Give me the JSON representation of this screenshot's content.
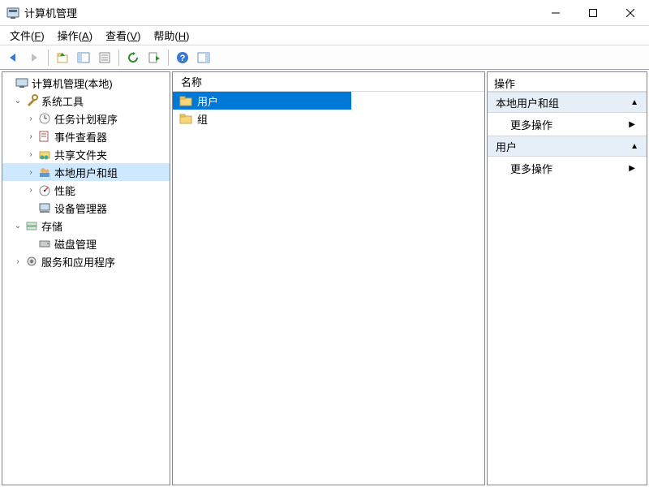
{
  "window": {
    "title": "计算机管理"
  },
  "menu": {
    "file": {
      "label": "文件",
      "hotkey": "F"
    },
    "action": {
      "label": "操作",
      "hotkey": "A"
    },
    "view": {
      "label": "查看",
      "hotkey": "V"
    },
    "help": {
      "label": "帮助",
      "hotkey": "H"
    }
  },
  "tree": {
    "root": "计算机管理(本地)",
    "system_tools": "系统工具",
    "task_scheduler": "任务计划程序",
    "event_viewer": "事件查看器",
    "shared_folders": "共享文件夹",
    "local_users_groups": "本地用户和组",
    "performance": "性能",
    "device_manager": "设备管理器",
    "storage": "存储",
    "disk_mgmt": "磁盘管理",
    "services_apps": "服务和应用程序"
  },
  "list": {
    "header_name": "名称",
    "items": [
      {
        "label": "用户",
        "selected": true
      },
      {
        "label": "组",
        "selected": false
      }
    ]
  },
  "actions": {
    "title": "操作",
    "sections": [
      {
        "header": "本地用户和组",
        "link": "更多操作"
      },
      {
        "header": "用户",
        "link": "更多操作"
      }
    ]
  }
}
